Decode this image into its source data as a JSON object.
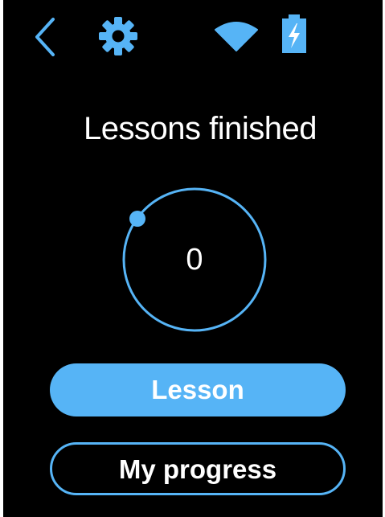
{
  "colors": {
    "background": "#000000",
    "accent": "#56b4f6",
    "text": "#ffffff"
  },
  "status_bar": {
    "icons": [
      "back-icon",
      "gear-icon",
      "wifi-icon",
      "battery-charging-icon"
    ]
  },
  "main": {
    "title": "Lessons finished",
    "lessons_finished_count": "0",
    "progress_fraction": 0
  },
  "actions": {
    "lesson_label": "Lesson",
    "progress_label": "My progress"
  }
}
